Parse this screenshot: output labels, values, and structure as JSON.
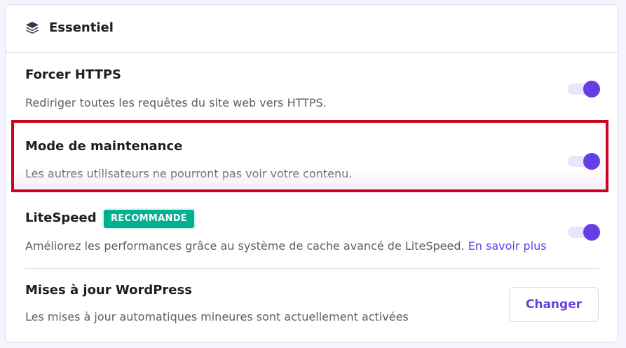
{
  "header": {
    "icon": "layers-icon",
    "title": "Essentiel"
  },
  "settings": [
    {
      "title": "Forcer HTTPS",
      "description": "Rediriger toutes les requêtes du site web vers HTTPS.",
      "toggle_on": true
    },
    {
      "title": "Mode de maintenance",
      "description": "Les autres utilisateurs ne pourront pas voir votre contenu.",
      "toggle_on": true,
      "highlighted": true
    },
    {
      "title": "LiteSpeed",
      "badge": "RECOMMANDÉ",
      "description": "Améliorez les performances grâce au système de cache avancé de LiteSpeed.",
      "link": "En savoir plus",
      "toggle_on": true
    },
    {
      "title": "Mises à jour WordPress",
      "description": "Les mises à jour automatiques mineures sont actuellement activées",
      "button": "Changer"
    }
  ],
  "colors": {
    "accent": "#673de6",
    "toggle_track": "#ebe4ff",
    "badge": "#00b090",
    "highlight_border": "#d0021b"
  }
}
